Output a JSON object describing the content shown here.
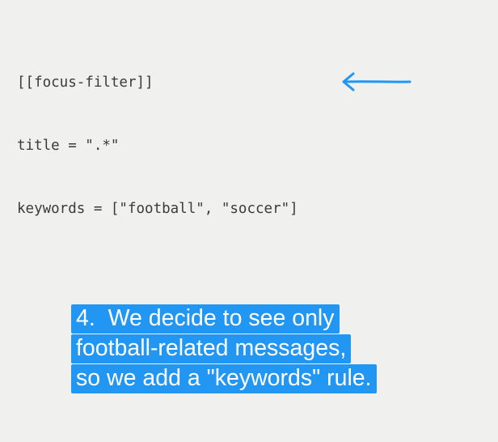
{
  "code": {
    "lines": [
      "[[focus-filter]]",
      "title = \".*\"",
      "keywords = [\"football\", \"soccer\"]"
    ]
  },
  "annotation": {
    "arrow_icon": "left-arrow-icon",
    "arrow_color": "#2196f3"
  },
  "caption": {
    "lines": [
      "4.  We decide to see only",
      "football-related messages,",
      "so we add a \"keywords\" rule."
    ],
    "background_color": "#2196f3",
    "text_color": "#ffffff"
  }
}
